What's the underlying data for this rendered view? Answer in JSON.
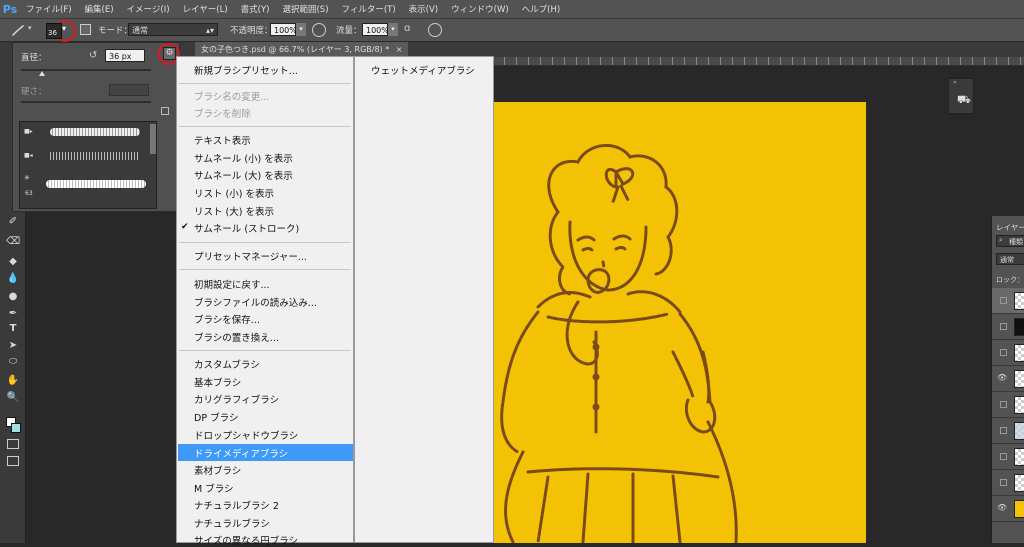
{
  "app": {
    "logo": "Ps"
  },
  "menubar": {
    "items": [
      "ファイル(F)",
      "編集(E)",
      "イメージ(I)",
      "レイヤー(L)",
      "書式(Y)",
      "選択範囲(S)",
      "フィルター(T)",
      "表示(V)",
      "ウィンドウ(W)",
      "ヘルプ(H)"
    ]
  },
  "options": {
    "brush_size_small": "36",
    "mode_label": "モード：",
    "mode_value": "通常",
    "opacity_label": "不透明度：",
    "opacity_value": "100%",
    "flow_label": "流量：",
    "flow_value": "100%"
  },
  "document": {
    "tab_title": "女の子色つき.psd @ 66.7% (レイヤー 3, RGB/8) *",
    "tab_close": "×",
    "canvas_color": "#f3c205",
    "line_color": "#7a4a1a"
  },
  "brush_panel": {
    "size_label": "直径：",
    "size_value": "36 px",
    "hardness_label": "硬さ：",
    "presets": [
      {
        "size": ""
      },
      {
        "size": ""
      },
      {
        "size": "63"
      }
    ]
  },
  "dropdown": {
    "items": [
      {
        "label": "新規ブラシプリセット...",
        "disabled": false
      },
      {
        "label": "ブラシ名の変更...",
        "disabled": true
      },
      {
        "label": "ブラシを削除",
        "disabled": true
      },
      {
        "label": "テキスト表示",
        "disabled": false
      },
      {
        "label": "サムネール (小) を表示",
        "disabled": false
      },
      {
        "label": "サムネール (大) を表示",
        "disabled": false
      },
      {
        "label": "リスト (小) を表示",
        "disabled": false
      },
      {
        "label": "リスト (大) を表示",
        "disabled": false
      },
      {
        "label": "サムネール (ストローク)",
        "disabled": false,
        "checked": true
      },
      {
        "label": "プリセットマネージャー...",
        "disabled": false
      },
      {
        "label": "初期設定に戻す...",
        "disabled": false
      },
      {
        "label": "ブラシファイルの読み込み...",
        "disabled": false
      },
      {
        "label": "ブラシを保存...",
        "disabled": false
      },
      {
        "label": "ブラシの置き換え...",
        "disabled": false
      },
      {
        "label": "カスタムブラシ",
        "disabled": false
      },
      {
        "label": "基本ブラシ",
        "disabled": false
      },
      {
        "label": "カリグラフィブラシ",
        "disabled": false
      },
      {
        "label": "DP ブラシ",
        "disabled": false
      },
      {
        "label": "ドロップシャドウブラシ",
        "disabled": false
      },
      {
        "label": "ドライメディアブラシ",
        "disabled": false,
        "highlighted": true
      },
      {
        "label": "素材ブラシ",
        "disabled": false
      },
      {
        "label": "M ブラシ",
        "disabled": false
      },
      {
        "label": "ナチュラルブラシ 2",
        "disabled": false
      },
      {
        "label": "ナチュラルブラシ",
        "disabled": false
      },
      {
        "label": "サイズの異なる円ブラシ",
        "disabled": false
      }
    ],
    "checkmark": "✔"
  },
  "submenu": {
    "first_item": "ウェットメディアブラシ"
  },
  "layers_panel": {
    "title": "レイヤー",
    "kind_label": "種類",
    "blend_label": "通常",
    "lock_label": "ロック：",
    "eye_glyph": "👁"
  },
  "colors": {
    "highlight": "#3e9af6",
    "annotation_red": "#e0161b"
  }
}
